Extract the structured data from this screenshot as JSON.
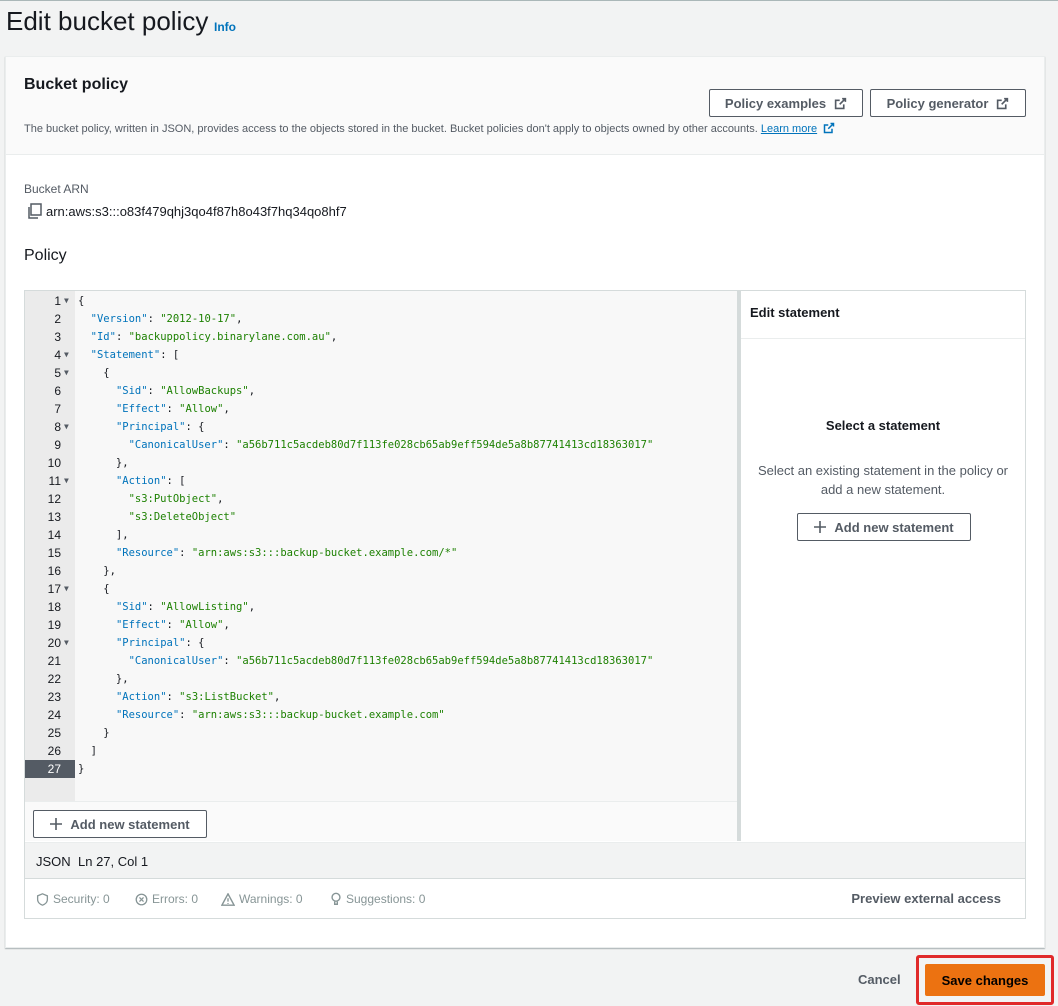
{
  "page": {
    "title": "Edit bucket policy",
    "info_link": "Info"
  },
  "bucket_policy": {
    "heading": "Bucket policy",
    "description": "The bucket policy, written in JSON, provides access to the objects stored in the bucket. Bucket policies don't apply to objects owned by other accounts.",
    "learn_more": "Learn more",
    "policy_examples_button": "Policy examples",
    "policy_generator_button": "Policy generator"
  },
  "arn": {
    "label": "Bucket ARN",
    "value": "arn:aws:s3:::o83f479qhj3qo4f87h8o43f7hq34qo8hf7",
    "copy_icon": "copy-icon"
  },
  "policy": {
    "label": "Policy",
    "lines": [
      {
        "n": "1",
        "fold": true,
        "text": "{"
      },
      {
        "n": "2",
        "fold": false,
        "text": "  \"Version\": \"2012-10-17\","
      },
      {
        "n": "3",
        "fold": false,
        "text": "  \"Id\": \"backuppolicy.binarylane.com.au\","
      },
      {
        "n": "4",
        "fold": true,
        "text": "  \"Statement\": ["
      },
      {
        "n": "5",
        "fold": true,
        "text": "    {"
      },
      {
        "n": "6",
        "fold": false,
        "text": "      \"Sid\": \"AllowBackups\","
      },
      {
        "n": "7",
        "fold": false,
        "text": "      \"Effect\": \"Allow\","
      },
      {
        "n": "8",
        "fold": true,
        "text": "      \"Principal\": {"
      },
      {
        "n": "9",
        "fold": false,
        "text": "        \"CanonicalUser\": \"a56b711c5acdeb80d7f113fe028cb65ab9eff594de5a8b87741413cd18363017\""
      },
      {
        "n": "10",
        "fold": false,
        "text": "      },"
      },
      {
        "n": "11",
        "fold": true,
        "text": "      \"Action\": ["
      },
      {
        "n": "12",
        "fold": false,
        "text": "        \"s3:PutObject\","
      },
      {
        "n": "13",
        "fold": false,
        "text": "        \"s3:DeleteObject\""
      },
      {
        "n": "14",
        "fold": false,
        "text": "      ],"
      },
      {
        "n": "15",
        "fold": false,
        "text": "      \"Resource\": \"arn:aws:s3:::backup-bucket.example.com/*\""
      },
      {
        "n": "16",
        "fold": false,
        "text": "    },"
      },
      {
        "n": "17",
        "fold": true,
        "text": "    {"
      },
      {
        "n": "18",
        "fold": false,
        "text": "      \"Sid\": \"AllowListing\","
      },
      {
        "n": "19",
        "fold": false,
        "text": "      \"Effect\": \"Allow\","
      },
      {
        "n": "20",
        "fold": true,
        "text": "      \"Principal\": {"
      },
      {
        "n": "21",
        "fold": false,
        "text": "        \"CanonicalUser\": \"a56b711c5acdeb80d7f113fe028cb65ab9eff594de5a8b87741413cd18363017\""
      },
      {
        "n": "22",
        "fold": false,
        "text": "      },"
      },
      {
        "n": "23",
        "fold": false,
        "text": "      \"Action\": \"s3:ListBucket\","
      },
      {
        "n": "24",
        "fold": false,
        "text": "      \"Resource\": \"arn:aws:s3:::backup-bucket.example.com\""
      },
      {
        "n": "25",
        "fold": false,
        "text": "    }"
      },
      {
        "n": "26",
        "fold": false,
        "text": "  ]"
      },
      {
        "n": "27",
        "fold": false,
        "text": "}"
      }
    ],
    "active_line": "27",
    "add_statement_button": "Add new statement"
  },
  "edit_statement": {
    "title": "Edit statement",
    "empty_title": "Select a statement",
    "empty_desc": "Select an existing statement in the policy or add a new statement.",
    "add_button": "Add new statement"
  },
  "status": {
    "mode": "JSON",
    "cursor": "Ln 27, Col 1"
  },
  "validation": {
    "security": "Security: 0",
    "errors": "Errors: 0",
    "warnings": "Warnings: 0",
    "suggestions": "Suggestions: 0",
    "preview": "Preview external access"
  },
  "actions": {
    "cancel": "Cancel",
    "save": "Save changes"
  },
  "colors": {
    "primary": "#ec7211",
    "link": "#0073bb",
    "highlight": "#e02a2a",
    "json_key": "#0073bb",
    "json_string": "#1d8102"
  }
}
